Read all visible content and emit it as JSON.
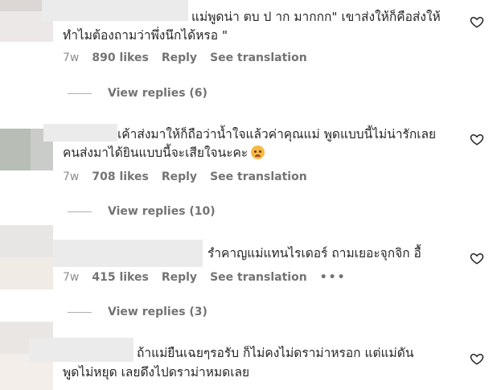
{
  "comments": [
    {
      "text_lines": [
        "แม่พูดน่า ตบ ป าก มากกก\" เขาส่งให้ก็คือส่งให้",
        "ทำไมต้องถามว่าพึ่งนึกได้หรอ \""
      ],
      "time": "7w",
      "likes": "890 likes",
      "reply": "Reply",
      "translate": "See translation",
      "view_replies": "View replies (6)"
    },
    {
      "text_lines": [
        "เค้าส่งมาให้ก็ถือว่าน้ำใจแล้วค่าคุณแม่ พูดแบบนี้ไม่น่ารักเลย",
        "คนส่งมาได้ยินแบบนี้จะเสียใจนะคะ"
      ],
      "emoji": "pleading-face-emoji",
      "time": "7w",
      "likes": "708 likes",
      "reply": "Reply",
      "translate": "See translation",
      "view_replies": "View replies (10)"
    },
    {
      "text_lines": [
        "รำคาญแม่แทนไรเดอร์ ถามเยอะจุกจิก อื้"
      ],
      "time": "7w",
      "likes": "415 likes",
      "reply": "Reply",
      "translate": "See translation",
      "more": "•••",
      "view_replies": "View replies (3)"
    },
    {
      "text_lines": [
        "ถ้าแม่ยืนเฉยๆรอรับ ก็ไม่คงไม่ดราม่าหรอก แต่แม่ดัน",
        "พูดไม่หยุด เลยดึงไปดราม่าหมดเลย"
      ]
    }
  ],
  "icons": {
    "like": "heart-outline-icon",
    "more": "more-horizontal-icon"
  }
}
